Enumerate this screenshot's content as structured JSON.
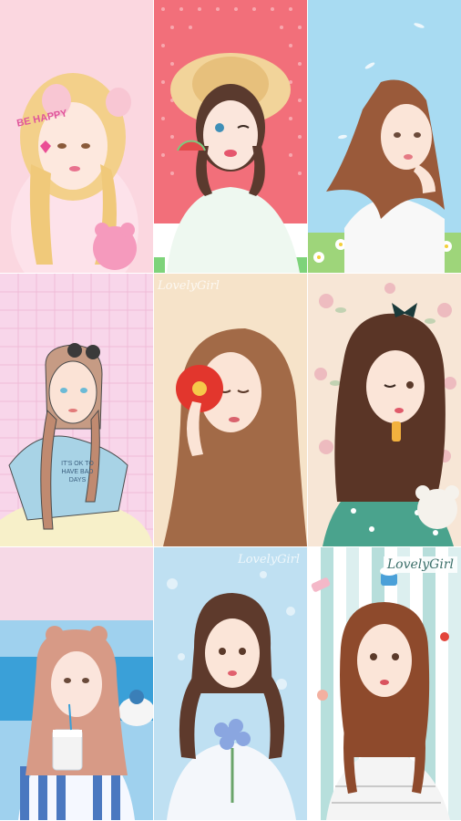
{
  "gallery": {
    "wallpapers": [
      {
        "id": 1,
        "bg": "#fbd7e0",
        "caption": "BE HAPPY"
      },
      {
        "id": 2,
        "bg": "#f26f7a",
        "caption": ""
      },
      {
        "id": 3,
        "bg": "#a8dbf2",
        "caption": ""
      },
      {
        "id": 4,
        "bg": "#f8d6ea",
        "caption": "IT'S OK TO HAVE BAD DAYS"
      },
      {
        "id": 5,
        "bg": "#f6e3c9",
        "caption": "LovelyGirl"
      },
      {
        "id": 6,
        "bg": "#f7e6d6",
        "caption": ""
      },
      {
        "id": 7,
        "bg": "#9fd1ee",
        "caption": ""
      },
      {
        "id": 8,
        "bg": "#bfe0f2",
        "caption": "LovelyGirl"
      },
      {
        "id": 9,
        "bg": "#dcefef",
        "caption": "LovelyGirl"
      }
    ]
  }
}
